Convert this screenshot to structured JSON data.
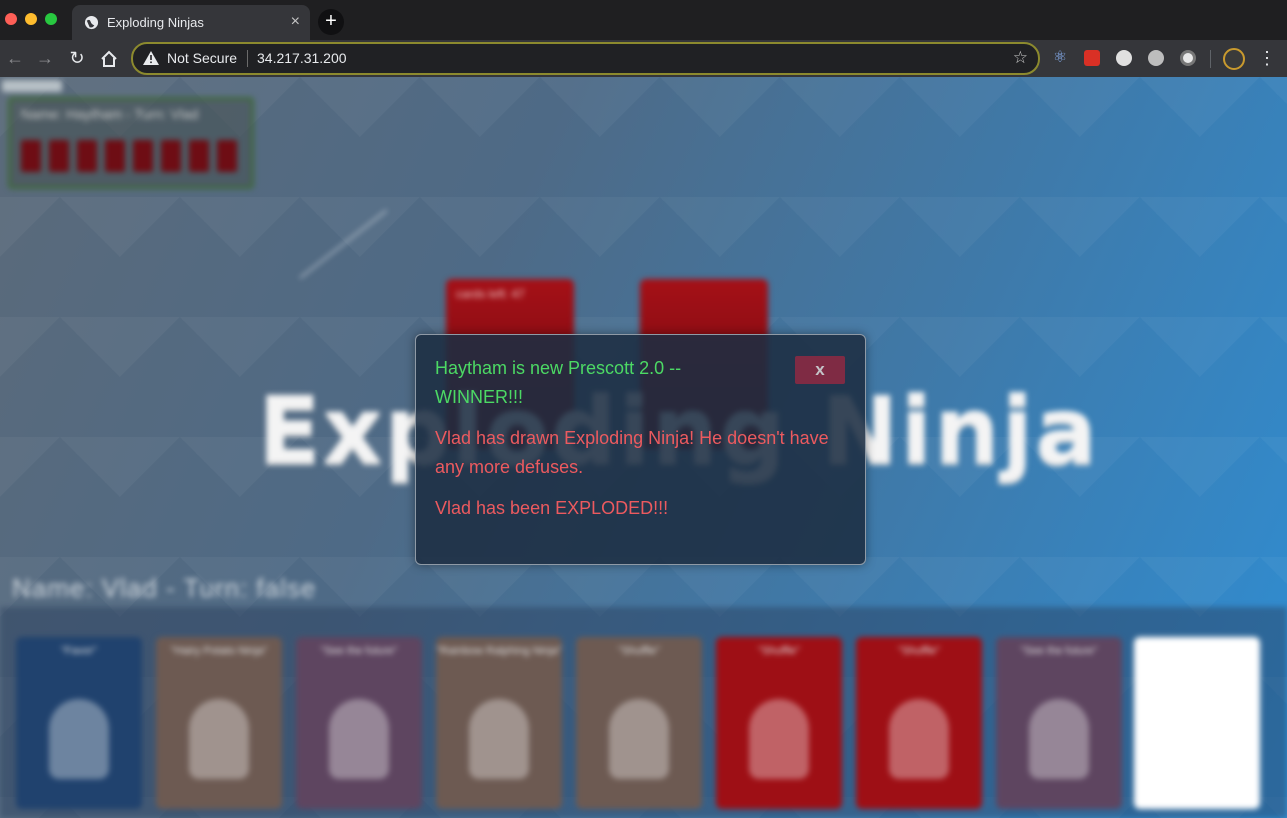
{
  "browser": {
    "tab_title": "Exploding Ninjas",
    "tab_close": "×",
    "new_tab": "+",
    "security_label": "Not Secure",
    "url": "34.217.31.200",
    "colors": {
      "titlebar": "#1f1f21",
      "toolbar": "#35363a",
      "omnibox_border": "#8c8a2e"
    }
  },
  "game": {
    "title": "Exploding Ninja",
    "opponent_label": "Name: Haytham - Turn: Vlad",
    "opponent_cards": 8,
    "deck_label": "cards left: 47",
    "player_label": "Name: Vlad - Turn: false",
    "hand": [
      {
        "title": "\"Favor\"",
        "color": "#20426e"
      },
      {
        "title": "\"Hairy Potato Ninja\"",
        "color": "#6d5a52"
      },
      {
        "title": "\"See the future\"",
        "color": "#5e4560"
      },
      {
        "title": "\"Rainbow Ralphing Ninja\"",
        "color": "#6d5a52"
      },
      {
        "title": "\"Shuffle\"",
        "color": "#6d5a52"
      },
      {
        "title": "\"Shuffle\"",
        "color": "#9e0f15"
      },
      {
        "title": "\"Shuffle\"",
        "color": "#9e0f15"
      },
      {
        "title": "\"See the future\"",
        "color": "#5e4560"
      }
    ]
  },
  "modal": {
    "close_label": "x",
    "winner_message": "Haytham is new Prescott 2.0 -- WINNER!!!",
    "drawn_message": "Vlad has drawn Exploding Ninja! He doesn't have any more defuses.",
    "exploded_message": "Vlad has been EXPLODED!!!",
    "colors": {
      "winner": "#4cd964",
      "alert": "#ec5a5f",
      "close_button": "#7f2b44"
    }
  }
}
